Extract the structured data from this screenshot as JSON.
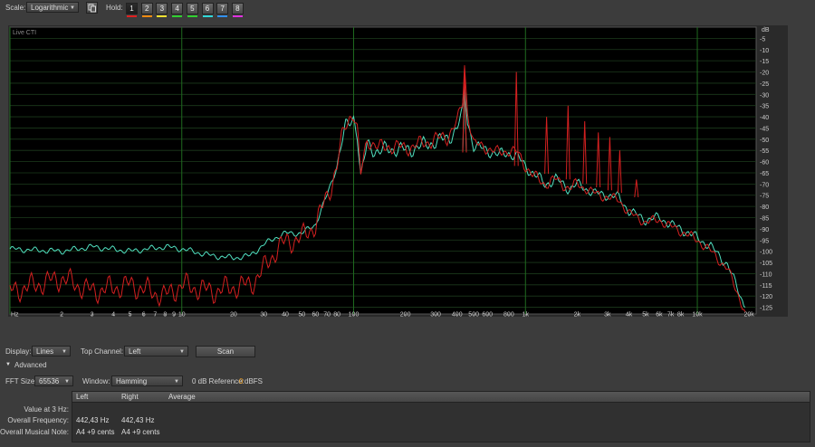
{
  "toolbar": {
    "scale_label": "Scale:",
    "scale_value": "Logarithmic",
    "hold_label": "Hold:",
    "hold_buttons": [
      {
        "label": "1",
        "color": "#e02020"
      },
      {
        "label": "2",
        "color": "#f08a10"
      },
      {
        "label": "3",
        "color": "#f0e030"
      },
      {
        "label": "4",
        "color": "#30d030"
      },
      {
        "label": "5",
        "color": "#30d030"
      },
      {
        "label": "6",
        "color": "#30d8d8"
      },
      {
        "label": "7",
        "color": "#3090f0"
      },
      {
        "label": "8",
        "color": "#e030e0"
      }
    ]
  },
  "plot": {
    "title": "Live CTI",
    "db_unit": "dB",
    "hz_unit": "Hz",
    "db_ticks": [
      -5,
      -10,
      -15,
      -20,
      -25,
      -30,
      -35,
      -40,
      -45,
      -50,
      -55,
      -60,
      -65,
      -70,
      -75,
      -80,
      -85,
      -90,
      -95,
      -100,
      -105,
      -110,
      -115,
      -120,
      -125
    ],
    "freq_ticks": [
      {
        "f": 2,
        "label": "2"
      },
      {
        "f": 3,
        "label": "3"
      },
      {
        "f": 4,
        "label": "4"
      },
      {
        "f": 5,
        "label": "5"
      },
      {
        "f": 6,
        "label": "6"
      },
      {
        "f": 7,
        "label": "7"
      },
      {
        "f": 8,
        "label": "8"
      },
      {
        "f": 9,
        "label": "9"
      },
      {
        "f": 10,
        "label": "10"
      },
      {
        "f": 20,
        "label": "20"
      },
      {
        "f": 30,
        "label": "30"
      },
      {
        "f": 40,
        "label": "40"
      },
      {
        "f": 50,
        "label": "50"
      },
      {
        "f": 60,
        "label": "60"
      },
      {
        "f": 70,
        "label": "70"
      },
      {
        "f": 80,
        "label": "80"
      },
      {
        "f": 100,
        "label": "100"
      },
      {
        "f": 200,
        "label": "200"
      },
      {
        "f": 300,
        "label": "300"
      },
      {
        "f": 400,
        "label": "400"
      },
      {
        "f": 500,
        "label": "500"
      },
      {
        "f": 600,
        "label": "600"
      },
      {
        "f": 800,
        "label": "800"
      },
      {
        "f": 1000,
        "label": "1k"
      },
      {
        "f": 2000,
        "label": "2k"
      },
      {
        "f": 3000,
        "label": "3k"
      },
      {
        "f": 4000,
        "label": "4k"
      },
      {
        "f": 5000,
        "label": "5k"
      },
      {
        "f": 6000,
        "label": "6k"
      },
      {
        "f": 7000,
        "label": "7k"
      },
      {
        "f": 8000,
        "label": "8k"
      },
      {
        "f": 10000,
        "label": "10k"
      },
      {
        "f": 20000,
        "label": "20k"
      }
    ],
    "colors": {
      "red": "#d42020",
      "cyan": "#50e0c0",
      "grid_major": "#1f6a1f",
      "grid_minor": "#1c3a1c",
      "bg": "#000000"
    }
  },
  "chart_data": {
    "type": "line",
    "xlabel": "Hz",
    "ylabel": "dB",
    "xscale": "log",
    "xlim": [
      1,
      22000
    ],
    "ylim": [
      -128,
      0
    ],
    "series": [
      {
        "color": "#50e0c0",
        "x": [
          1,
          2,
          3,
          5,
          8,
          10,
          15,
          20,
          25,
          30,
          35,
          40,
          50,
          60,
          70,
          80,
          85,
          90,
          95,
          100,
          105,
          110,
          120,
          140,
          160,
          200,
          250,
          300,
          350,
          400,
          430,
          442,
          460,
          500,
          600,
          700,
          800,
          900,
          1000,
          1100,
          1300,
          1500,
          1800,
          2000,
          2500,
          3000,
          3500,
          4000,
          5000,
          6000,
          7000,
          8000,
          10000,
          12000,
          15000,
          17000,
          19000
        ],
        "y": [
          -99,
          -100,
          -98,
          -100,
          -98,
          -99,
          -102,
          -103,
          -102,
          -97,
          -94,
          -92,
          -92,
          -88,
          -75,
          -62,
          -52,
          -45,
          -42,
          -40,
          -47,
          -68,
          -52,
          -56,
          -54,
          -55,
          -53,
          -51,
          -50,
          -45,
          -38,
          -26,
          -42,
          -53,
          -55,
          -57,
          -56,
          -58,
          -62,
          -65,
          -70,
          -68,
          -72,
          -70,
          -74,
          -75,
          -76,
          -82,
          -86,
          -85,
          -88,
          -90,
          -94,
          -98,
          -106,
          -116,
          -125
        ]
      },
      {
        "color": "#d42020",
        "x": [
          1,
          2,
          3,
          5,
          8,
          10,
          15,
          20,
          25,
          30,
          35,
          40,
          50,
          60,
          70,
          80,
          85,
          90,
          95,
          100,
          105,
          110,
          120,
          140,
          160,
          200,
          250,
          300,
          350,
          400,
          430,
          442,
          460,
          500,
          600,
          700,
          800,
          900,
          1000,
          1100,
          1300,
          1500,
          1800,
          2000,
          2500,
          3000,
          3500,
          4000,
          5000,
          6000,
          7000,
          8000,
          10000,
          12000,
          15000,
          17000,
          19000
        ],
        "y": [
          -118,
          -112,
          -118,
          -115,
          -120,
          -115,
          -118,
          -116,
          -115,
          -108,
          -100,
          -96,
          -94,
          -88,
          -76,
          -62,
          -50,
          -44,
          -40,
          -38,
          -46,
          -66,
          -50,
          -54,
          -53,
          -54,
          -52,
          -50,
          -49,
          -42,
          -34,
          -17,
          -38,
          -52,
          -54,
          -56,
          -55,
          -56,
          -62,
          -66,
          -70,
          -68,
          -72,
          -70,
          -74,
          -76,
          -77,
          -83,
          -87,
          -86,
          -89,
          -91,
          -95,
          -100,
          -108,
          -118,
          -127
        ]
      }
    ],
    "peaks": [
      {
        "series": 0,
        "f": 442,
        "y": -26
      },
      {
        "series": 1,
        "f": 442,
        "y": -17
      },
      {
        "series": 1,
        "f": 885,
        "y": -20
      },
      {
        "series": 1,
        "f": 1327,
        "y": -40
      },
      {
        "series": 1,
        "f": 1770,
        "y": -35
      },
      {
        "series": 1,
        "f": 2212,
        "y": -42
      },
      {
        "series": 1,
        "f": 2655,
        "y": -47
      },
      {
        "series": 1,
        "f": 3097,
        "y": -49
      },
      {
        "series": 1,
        "f": 3540,
        "y": -55
      },
      {
        "series": 1,
        "f": 4425,
        "y": -68
      }
    ]
  },
  "bottom": {
    "display_label": "Display:",
    "display_value": "Lines",
    "top_channel_label": "Top Channel:",
    "top_channel_value": "Left",
    "scan_label": "Scan",
    "advanced_label": "Advanced",
    "fft_label": "FFT Size:",
    "fft_value": "65536",
    "window_label": "Window:",
    "window_value": "Hamming",
    "ref_label": "0 dB Reference:",
    "ref_value": "0",
    "ref_unit": "dBFS",
    "table": {
      "headers": [
        "Left",
        "Right",
        "Average"
      ],
      "rows": [
        {
          "label": "Value at 3 Hz:",
          "left": "",
          "right": "",
          "average": ""
        },
        {
          "label": "Overall Frequency:",
          "left": "442,43 Hz",
          "right": "442,43 Hz",
          "average": ""
        },
        {
          "label": "Overall Musical Note:",
          "left": "A4 +9 cents",
          "right": "A4 +9 cents",
          "average": ""
        }
      ]
    }
  }
}
